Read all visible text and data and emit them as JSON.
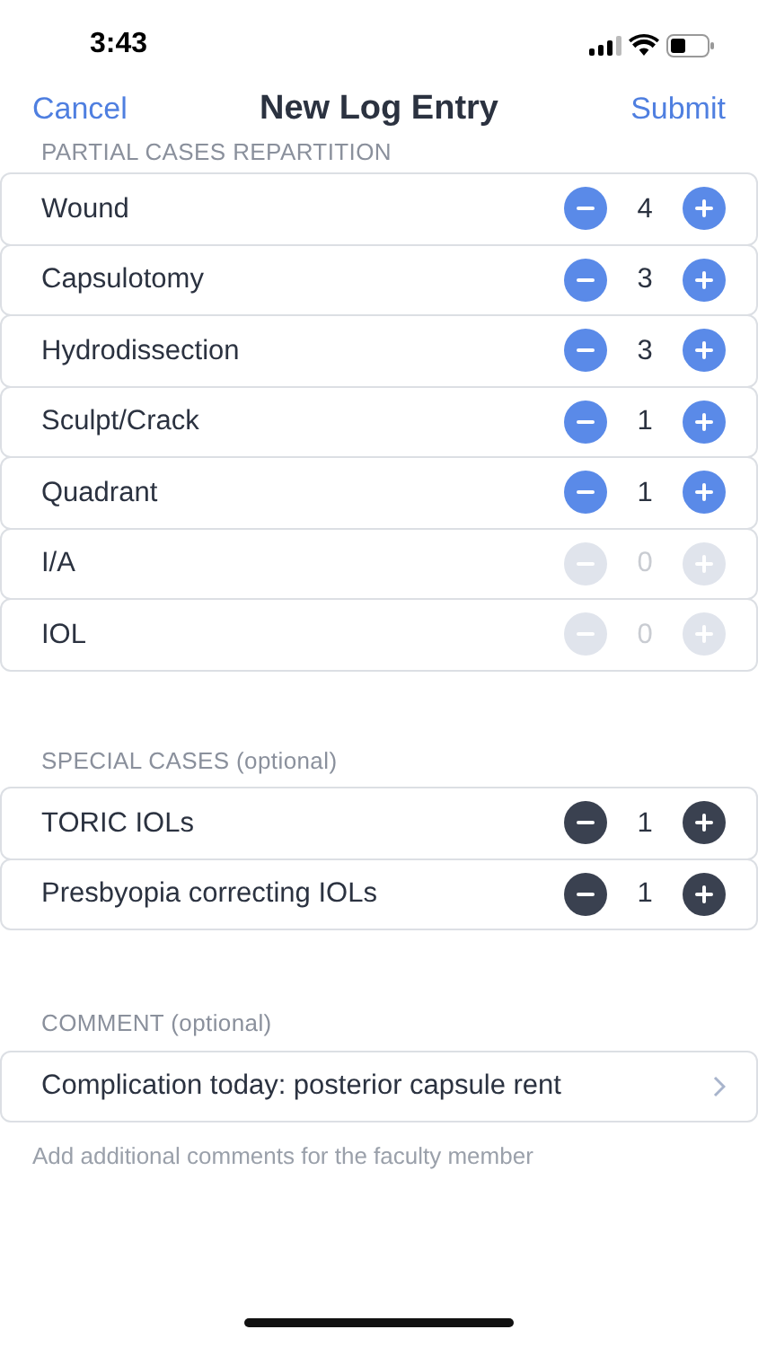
{
  "status_bar": {
    "time": "3:43"
  },
  "nav": {
    "cancel": "Cancel",
    "title": "New Log Entry",
    "submit": "Submit"
  },
  "sections": [
    {
      "header": "PARTIAL CASES REPARTITION",
      "color": "#5a8ae8",
      "rows": [
        {
          "label": "Wound",
          "value": "4",
          "disabled": false
        },
        {
          "label": "Capsulotomy",
          "value": "3",
          "disabled": false
        },
        {
          "label": "Hydrodissection",
          "value": "3",
          "disabled": false
        },
        {
          "label": "Sculpt/Crack",
          "value": "1",
          "disabled": false
        },
        {
          "label": "Quadrant",
          "value": "1",
          "disabled": false
        },
        {
          "label": "I/A",
          "value": "0",
          "disabled": true
        },
        {
          "label": "IOL",
          "value": "0",
          "disabled": true
        }
      ]
    },
    {
      "header": "SPECIAL CASES (optional)",
      "color": "#3a4150",
      "rows": [
        {
          "label": "TORIC IOLs",
          "value": "1",
          "disabled": false
        },
        {
          "label": "Presbyopia correcting IOLs",
          "value": "1",
          "disabled": false
        }
      ]
    }
  ],
  "comment": {
    "header": "COMMENT (optional)",
    "value": "Complication today: posterior capsule rent",
    "footer": "Add additional comments for the faculty member"
  }
}
